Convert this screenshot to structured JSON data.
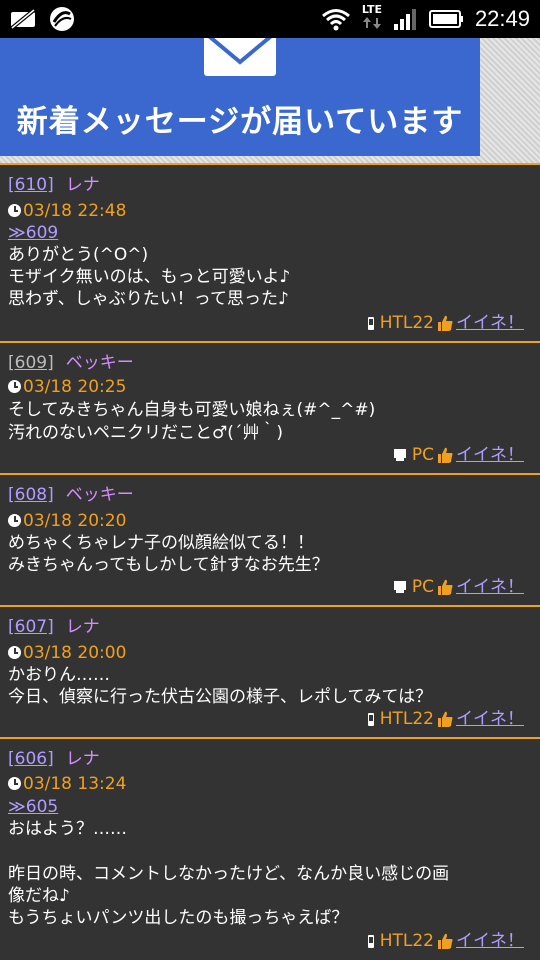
{
  "status_bar": {
    "time": "22:49",
    "network": "LTE",
    "left_icons": [
      "no-sim-icon",
      "app-notification-icon"
    ],
    "right_icons": [
      "wifi-icon",
      "lte-icon",
      "signal-icon",
      "battery-icon"
    ]
  },
  "banner": {
    "title": "新着メッセージが届いています",
    "icon": "envelope-icon",
    "color": "#3a68cf"
  },
  "colors": {
    "background": "#333333",
    "separator": "#f0a020",
    "post_number": "#b09cff",
    "author_name": "#d58cff",
    "date": "#f0a020",
    "device": "#f0a020",
    "like_link": "#b09cff"
  },
  "posts": [
    {
      "number": "[610]",
      "author": "レナ",
      "datetime": "03/18 22:48",
      "reply_to": "≫609",
      "lines": [
        "ありがとう(^O^)",
        "モザイク無いのは、もっと可愛いよ♪",
        "思わず、しゃぶりたい！って思った♪"
      ],
      "device": "HTL22",
      "device_icon": "mobile-phone-icon",
      "like_label": "イイネ！"
    },
    {
      "number": "[609]",
      "author": "ベッキー",
      "datetime": "03/18 20:25",
      "reply_to": "",
      "lines": [
        "そしてみきちゃん自身も可愛い娘ねぇ(#^_^#)",
        "汚れのないペニクリだこと♂(´艸｀)"
      ],
      "device": "PC",
      "device_icon": "pc-icon",
      "like_label": "イイネ！"
    },
    {
      "number": "[608]",
      "author": "ベッキー",
      "datetime": "03/18 20:20",
      "reply_to": "",
      "lines": [
        "めちゃくちゃレナ子の似顔絵似てる！！",
        "みきちゃんってもしかして針すなお先生？"
      ],
      "device": "PC",
      "device_icon": "pc-icon",
      "like_label": "イイネ！"
    },
    {
      "number": "[607]",
      "author": "レナ",
      "datetime": "03/18 20:00",
      "reply_to": "",
      "lines": [
        "かおりん……",
        "今日、偵察に行った伏古公園の様子、レポしてみては？"
      ],
      "device": "HTL22",
      "device_icon": "mobile-phone-icon",
      "like_label": "イイネ！"
    },
    {
      "number": "[606]",
      "author": "レナ",
      "datetime": "03/18 13:24",
      "reply_to": "≫605",
      "lines": [
        "おはよう？……",
        "",
        "昨日の時、コメントしなかったけど、なんか良い感じの画",
        "像だね♪",
        "もうちょいパンツ出したのも撮っちゃえば？"
      ],
      "device": "HTL22",
      "device_icon": "mobile-phone-icon",
      "like_label": "イイネ！"
    }
  ]
}
